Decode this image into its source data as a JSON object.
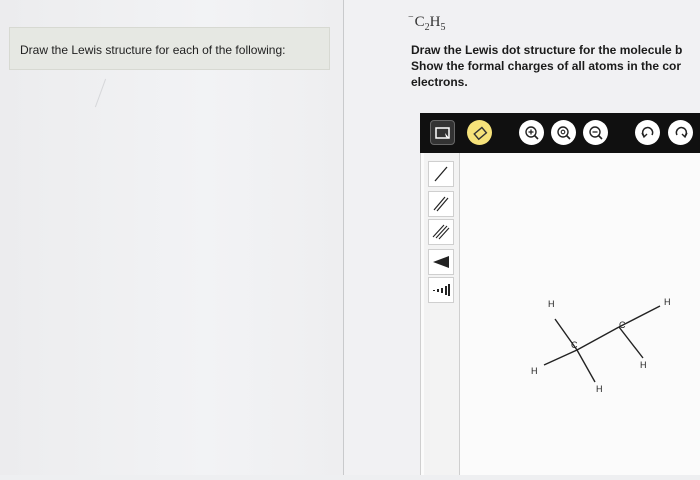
{
  "left": {
    "prompt": "Draw the Lewis structure for each of the following:"
  },
  "right": {
    "formula": {
      "charge": "−",
      "c": "C",
      "c_count": "2",
      "h": "H",
      "h_count": "5"
    },
    "instructions": [
      "Draw the Lewis dot structure for the molecule b",
      "Show the formal charges of all atoms in the cor",
      "electrons."
    ],
    "toolbar": {
      "tools": [
        "select-icon",
        "eraser-icon",
        "zoom-in-icon",
        "zoom-reset-icon",
        "zoom-out-icon",
        "undo-icon",
        "redo-icon"
      ],
      "accent": "#f6e27a"
    },
    "side_tools": [
      "single-bond-icon",
      "double-bond-icon",
      "triple-bond-icon",
      "wedge-bond-icon",
      "hash-bond-icon"
    ],
    "molecule": {
      "atoms": {
        "h_top_left": "H",
        "h_top_right": "H",
        "c_upper": "C",
        "c_center": "C",
        "h_left": "H",
        "h_bottom": "H",
        "h_right": "H"
      }
    }
  }
}
